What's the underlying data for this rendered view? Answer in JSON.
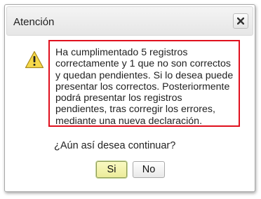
{
  "dialog": {
    "title": "Atención",
    "close_icon": "close-icon",
    "warning_icon": "warning-triangle-icon",
    "message_lines": [
      "Ha cumplimentado 5 registros",
      "correctamente y 1 que no son correctos",
      "y quedan pendientes. Si lo desea puede",
      "presentar los correctos. Posteriormente",
      "podrá presentar los registros",
      "pendientes, tras corregir los errores,",
      "mediante una nueva declaración."
    ],
    "question": "¿Aún así desea continuar?",
    "yes_label": "Si",
    "no_label": "No"
  },
  "colors": {
    "highlight_border": "#e0101e",
    "warning_fill": "#f6d94a",
    "yes_button": "#f3f3b0"
  }
}
